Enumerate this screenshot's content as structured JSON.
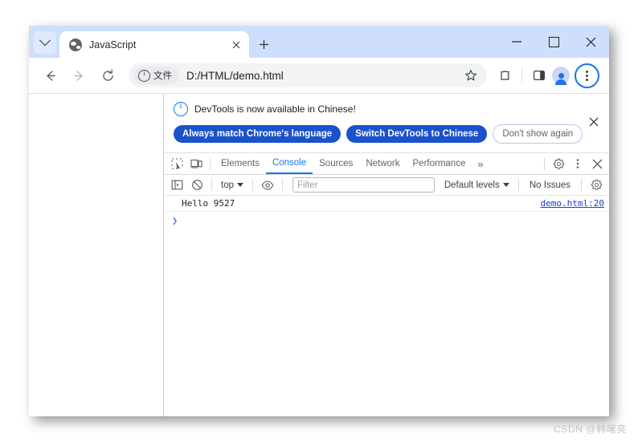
{
  "window": {
    "titlebar": {
      "tab_search_icon": "chevron-down-icon",
      "tab": {
        "favicon": "globe-favicon",
        "title": "JavaScript",
        "close_icon": "close-icon"
      },
      "new_tab_icon": "plus-icon",
      "controls": {
        "minimize": "minimize-icon",
        "maximize": "maximize-icon",
        "close": "close-icon"
      }
    },
    "toolbar": {
      "back_icon": "back-arrow-icon",
      "forward_icon": "forward-arrow-icon",
      "reload_icon": "reload-icon",
      "omnibox": {
        "security_chip_icon": "info-circle-icon",
        "security_chip_label": "文件",
        "url": "D:/HTML/demo.html"
      },
      "bookmark_icon": "star-icon",
      "extensions_icon": "puzzle-piece-icon",
      "side_panel_icon": "side-panel-icon",
      "profile_icon": "avatar-icon",
      "menu_icon": "three-dots-vertical-icon"
    }
  },
  "devtools": {
    "banner": {
      "info_icon": "info-circle-icon",
      "message": "DevTools is now available in Chinese!",
      "buttons": [
        {
          "label": "Always match Chrome's language",
          "style": "primary"
        },
        {
          "label": "Switch DevTools to Chinese",
          "style": "primary"
        },
        {
          "label": "Don't show again",
          "style": "outline"
        }
      ],
      "close_icon": "close-icon"
    },
    "tabbar": {
      "inspect_icon": "inspect-element-icon",
      "device_icon": "device-toolbar-icon",
      "tabs": [
        {
          "label": "Elements",
          "active": false
        },
        {
          "label": "Console",
          "active": true
        },
        {
          "label": "Sources",
          "active": false
        },
        {
          "label": "Network",
          "active": false
        },
        {
          "label": "Performance",
          "active": false
        }
      ],
      "overflow_label": "»",
      "settings_icon": "gear-icon",
      "more_icon": "three-dots-vertical-icon",
      "close_icon": "close-icon"
    },
    "console_toolbar": {
      "sidebar_icon": "console-sidebar-icon",
      "clear_icon": "clear-console-icon",
      "context_label": "top",
      "eye_icon": "eye-icon",
      "filter_placeholder": "Filter",
      "filter_value": "",
      "levels_label": "Default levels",
      "issues_label": "No Issues",
      "settings_icon": "gear-icon"
    },
    "console": {
      "messages": [
        {
          "text": "Hello 9527",
          "source": "demo.html:20"
        }
      ],
      "prompt_symbol": "❯"
    }
  },
  "watermark": "CSDN @韩曙亮",
  "colors": {
    "titlebar": "#cfdefb",
    "accent": "#1a73e8",
    "banner_button": "#1a52cc",
    "link": "#1a3fd4"
  }
}
